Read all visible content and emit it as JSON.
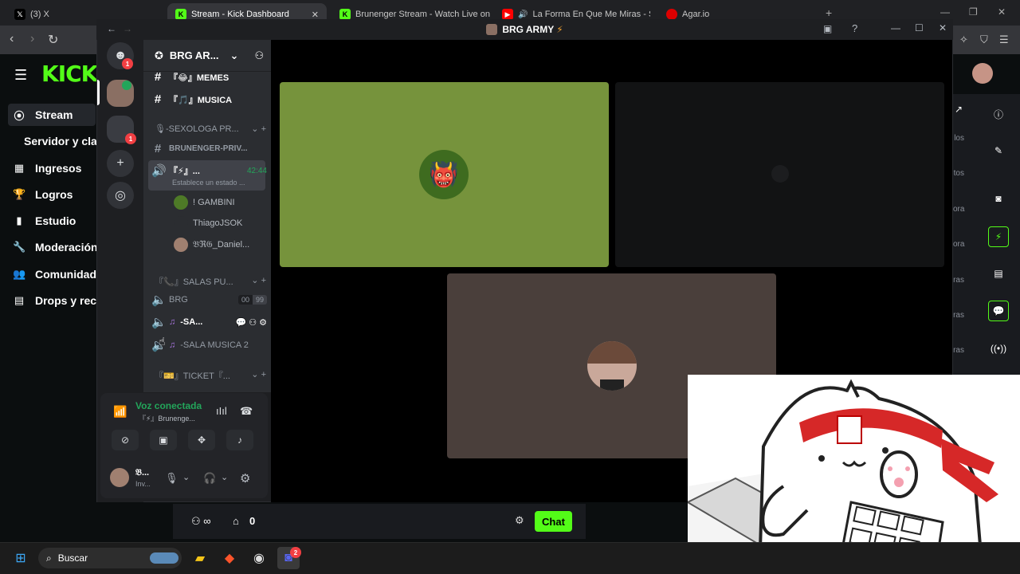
{
  "browser": {
    "tabs": [
      {
        "label": "(3) X",
        "icon": "x-logo-icon"
      },
      {
        "label": "Stream - Kick Dashboard",
        "icon": "kick-logo-icon",
        "active": true
      },
      {
        "label": "Brunenger Stream - Watch Live on Ki",
        "icon": "kick-logo-icon"
      },
      {
        "label": "La Forma En Que Me Miras - Sup",
        "icon": "youtube-icon"
      },
      {
        "label": "Agar.io",
        "icon": "agar-icon"
      }
    ]
  },
  "kick": {
    "logo": "KICK",
    "nav": [
      {
        "label": "Stream",
        "icon": "broadcast-icon"
      },
      {
        "label": "Servidor y clav",
        "icon": ""
      },
      {
        "label": "Ingresos",
        "icon": "chart-icon"
      },
      {
        "label": "Logros",
        "icon": "trophy-icon"
      },
      {
        "label": "Estudio",
        "icon": "studio-icon"
      },
      {
        "label": "Moderación",
        "icon": "wrench-icon"
      },
      {
        "label": "Comunidad",
        "icon": "community-icon"
      },
      {
        "label": "Drops y reco",
        "icon": "drops-icon"
      }
    ],
    "right_panel_rows": [
      "los",
      "tos",
      "ora",
      "ora",
      "ras",
      "ras",
      "ras"
    ],
    "bottom": {
      "count": "0",
      "chat_label": "Chat"
    },
    "accent": "#53fc18"
  },
  "discord": {
    "window_title": "BRG ARMY",
    "server_name": "BRG AR...",
    "server_badges": [
      "1",
      "1"
    ],
    "channels": [
      {
        "label": "『😂』MEMES",
        "type": "text"
      },
      {
        "label": "『🎵』MUSICA",
        "type": "text"
      },
      {
        "label": "🎙-SEXOLOGA PR...",
        "type": "category"
      },
      {
        "label": "BRUNENGER-PRIV...",
        "type": "text"
      },
      {
        "label": "『⚡』...",
        "type": "voice",
        "timer": "42:44",
        "status": "Establece un estado ..."
      }
    ],
    "members": [
      {
        "name": "! GAMBINI",
        "color": "#4e7a27"
      },
      {
        "name": "ThiagoJSOK",
        "color": "#2b2d31"
      },
      {
        "name": "𝔅ℜ𝔊_Daniel...",
        "color": "#a08070"
      }
    ],
    "category2": "『📞』SALAS PU...",
    "voice_channels": [
      {
        "label": "BRG",
        "counts": [
          "00",
          "99"
        ]
      },
      {
        "label": "-SA...",
        "bold": true
      },
      {
        "label": "-SALA MUSICA 2"
      }
    ],
    "category3": "『🎫』TICKET『...",
    "voice_panel": {
      "status": "Voz conectada",
      "channel": "『⚡』Brunenge...",
      "user": "𝔅...",
      "user_status": "Inv..."
    }
  },
  "taskbar": {
    "search_placeholder": "Buscar",
    "discord_badge": "2"
  }
}
